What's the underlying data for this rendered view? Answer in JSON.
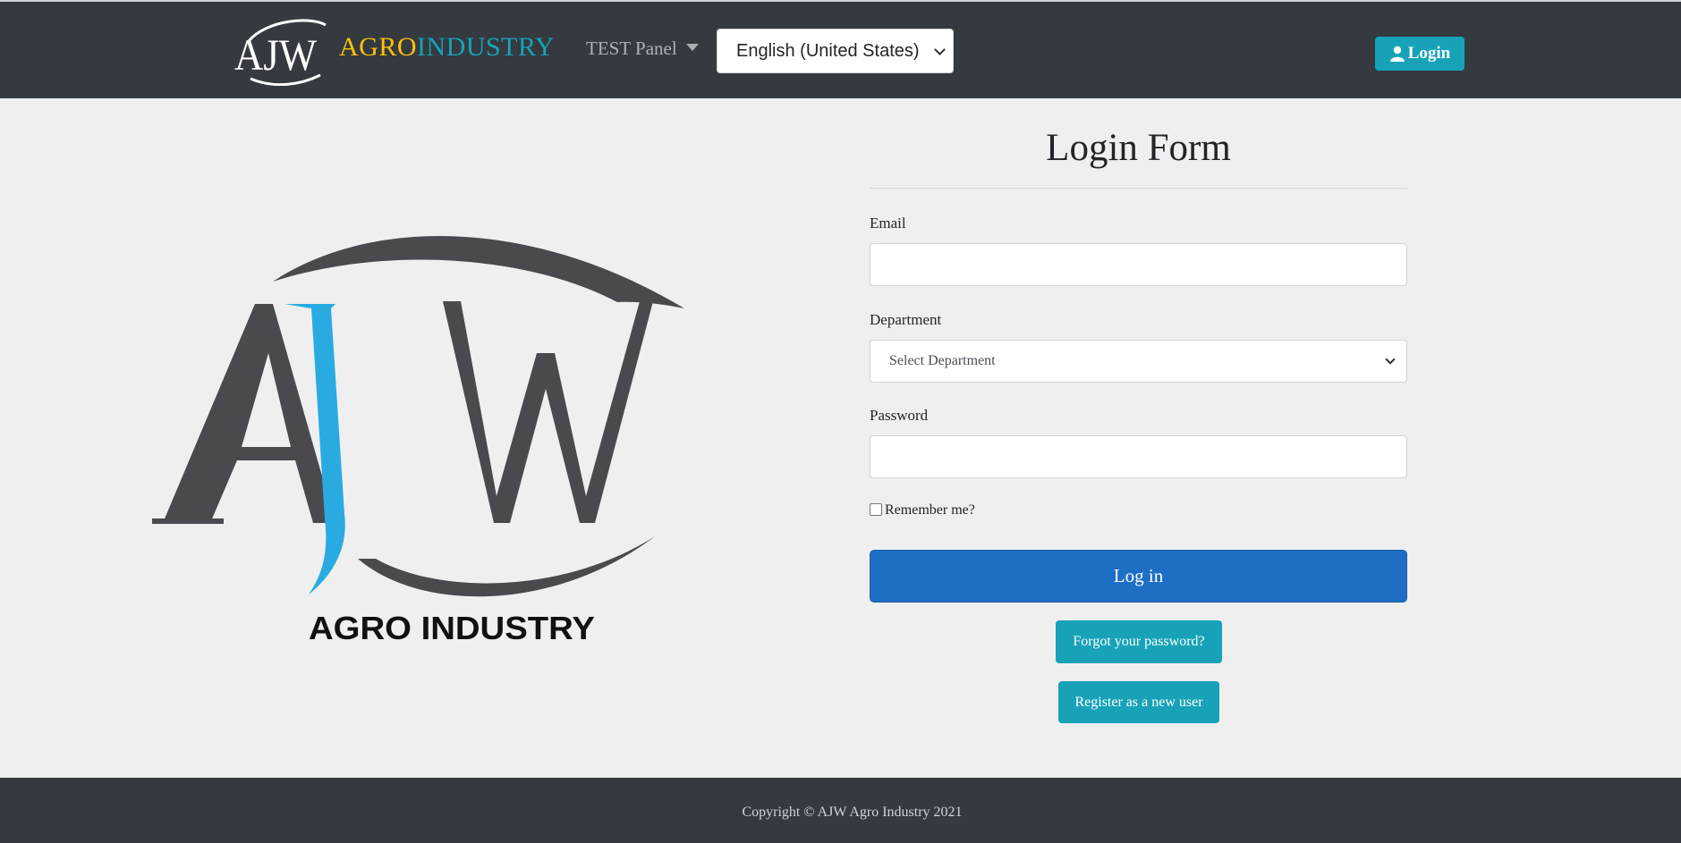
{
  "navbar": {
    "brand_monogram": "AJW",
    "brand_part1": "AGRO",
    "brand_part2": "INDUSTRY",
    "panel_dropdown": "TEST Panel",
    "language_selected": "English (United States)",
    "login_button": "Login",
    "login_icon": "user-icon"
  },
  "hero": {
    "logo_monogram": "AJW",
    "logo_caption": "AGRO INDUSTRY"
  },
  "form": {
    "title": "Login Form",
    "email_label": "Email",
    "email_value": "",
    "department_label": "Department",
    "department_selected": "Select Department",
    "password_label": "Password",
    "password_value": "",
    "remember_label": "Remember me?",
    "submit_label": "Log in",
    "forgot_label": "Forgot your password?",
    "register_label": "Register as a new user"
  },
  "footer": {
    "copyright": "Copyright © AJW Agro Industry 2021"
  },
  "colors": {
    "navbar_bg": "#343a40",
    "brand_agro": "#ffc107",
    "brand_industry": "#17a2b8",
    "primary_button": "#1e6ec6",
    "teal_button": "#17a2b8",
    "page_bg": "#efefef"
  }
}
